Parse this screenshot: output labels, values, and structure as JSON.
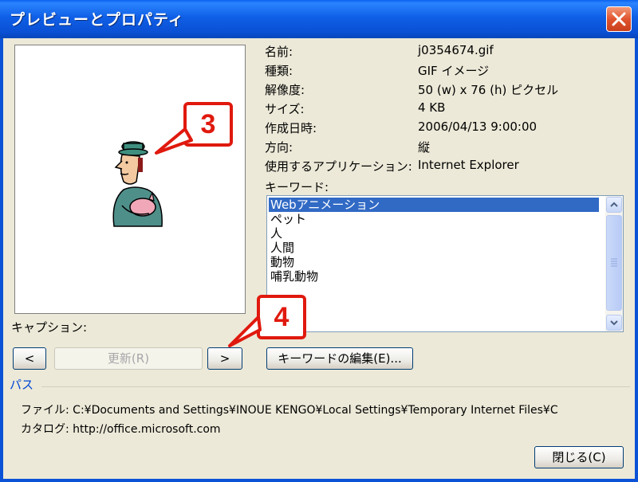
{
  "window": {
    "title": "プレビューとプロパティ"
  },
  "properties": [
    {
      "label": "名前:",
      "value": "j0354674.gif"
    },
    {
      "label": "種類:",
      "value": "GIF イメージ"
    },
    {
      "label": "解像度:",
      "value": "50 (w) x 76 (h) ピクセル"
    },
    {
      "label": "サイズ:",
      "value": "4 KB"
    },
    {
      "label": "作成日時:",
      "value": "2006/04/13 9:00:00"
    },
    {
      "label": "方向:",
      "value": "縦"
    },
    {
      "label": "使用するアプリケーション:",
      "value": "Internet Explorer"
    }
  ],
  "keywords": {
    "label": "キーワード:",
    "items": [
      "Webアニメーション",
      "ペット",
      "人",
      "人間",
      "動物",
      "哺乳動物"
    ],
    "selected_index": 0
  },
  "caption": {
    "label": "キャプション:"
  },
  "buttons": {
    "prev": "<",
    "update": "更新(R)",
    "next": ">",
    "edit_keywords": "キーワードの編集(E)...",
    "close": "閉じる(C)"
  },
  "path": {
    "group_label": "パス",
    "file_label": "ファイル:",
    "file_value": "C:¥Documents and Settings¥INOUE KENGO¥Local Settings¥Temporary Internet Files¥C",
    "catalog_label": "カタログ:",
    "catalog_value": "http://office.microsoft.com"
  },
  "callouts": [
    "3",
    "4"
  ],
  "colors": {
    "titlebar": "#0a52d6",
    "dialog": "#ece9d8",
    "selection": "#316ac5",
    "callout": "#e0190e"
  }
}
